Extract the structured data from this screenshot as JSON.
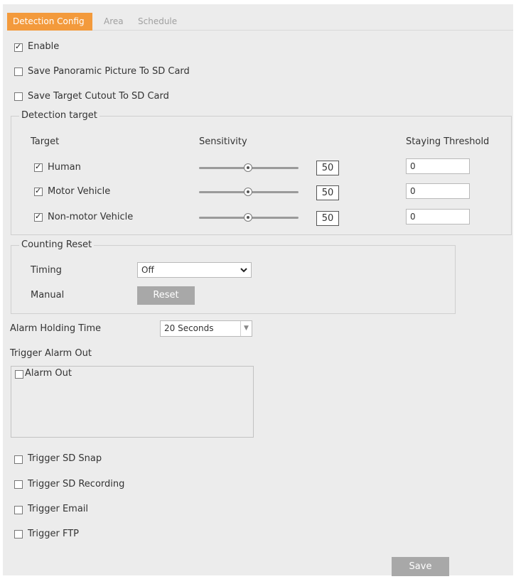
{
  "tabs": [
    {
      "label": "Detection Config",
      "active": true
    },
    {
      "label": "Area",
      "active": false
    },
    {
      "label": "Schedule",
      "active": false
    }
  ],
  "options": {
    "enable": {
      "label": "Enable",
      "checked": true
    },
    "save_panoramic": {
      "label": "Save Panoramic Picture To SD Card",
      "checked": false
    },
    "save_target": {
      "label": "Save Target Cutout To SD Card",
      "checked": false
    }
  },
  "detection_target": {
    "legend": "Detection target",
    "headers": {
      "target": "Target",
      "sensitivity": "Sensitivity",
      "threshold": "Staying Threshold"
    },
    "rows": [
      {
        "label": "Human",
        "checked": true,
        "sensitivity": "50",
        "threshold": "0"
      },
      {
        "label": "Motor Vehicle",
        "checked": true,
        "sensitivity": "50",
        "threshold": "0"
      },
      {
        "label": "Non-motor Vehicle",
        "checked": true,
        "sensitivity": "50",
        "threshold": "0"
      }
    ]
  },
  "counting_reset": {
    "legend": "Counting Reset",
    "timing_label": "Timing",
    "timing_value": "Off",
    "manual_label": "Manual",
    "reset_button": "Reset"
  },
  "alarm_holding": {
    "label": "Alarm Holding Time",
    "value": "20 Seconds"
  },
  "trigger_alarm_out": {
    "label": "Trigger Alarm Out",
    "alarm_out": {
      "label": "Alarm Out",
      "checked": false
    }
  },
  "triggers": [
    {
      "label": "Trigger SD Snap",
      "checked": false
    },
    {
      "label": "Trigger SD Recording",
      "checked": false
    },
    {
      "label": "Trigger Email",
      "checked": false
    },
    {
      "label": "Trigger FTP",
      "checked": false
    }
  ],
  "save_button": "Save",
  "colors": {
    "accent": "#f39a3c",
    "panel_bg": "#ececec",
    "button_bg": "#a8a8a8"
  }
}
